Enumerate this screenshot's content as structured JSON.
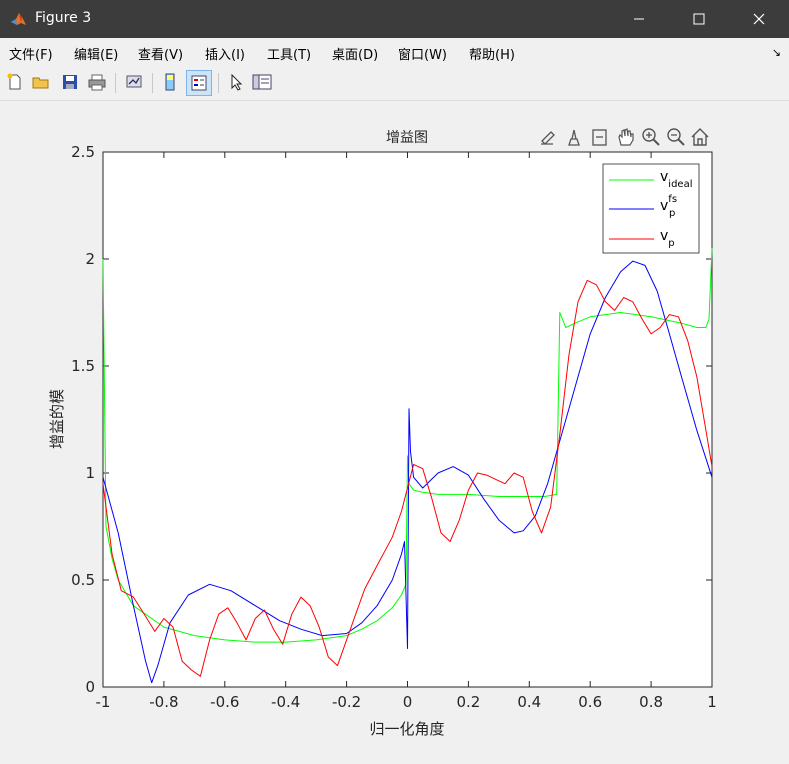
{
  "window": {
    "title": "Figure 3"
  },
  "menu": [
    "文件(F)",
    "编辑(E)",
    "查看(V)",
    "插入(I)",
    "工具(T)",
    "桌面(D)",
    "窗口(W)",
    "帮助(H)"
  ],
  "toolbar_icons": [
    "new-file-icon",
    "open-folder-icon",
    "save-icon",
    "print-icon",
    "link-plot-icon",
    "colorbar-icon",
    "legend-icon",
    "pointer-icon",
    "property-inspector-icon"
  ],
  "axes_toolbar_icons": [
    "brush-edit-icon",
    "data-cursor-icon",
    "zoom-region-icon",
    "pan-icon",
    "zoom-in-icon",
    "zoom-out-icon",
    "home-icon"
  ],
  "colors": {
    "ideal": "#00ff00",
    "pfs": "#0000ff",
    "p": "#ff0000",
    "titlebar": "#3c3c3c"
  },
  "chart_data": {
    "type": "line",
    "title": "增益图",
    "xlabel": "归一化角度",
    "ylabel": "增益的模",
    "xlim": [
      -1,
      1
    ],
    "ylim": [
      0,
      2.5
    ],
    "xticks": [
      -1,
      -0.8,
      -0.6,
      -0.4,
      -0.2,
      0,
      0.2,
      0.4,
      0.6,
      0.8,
      1
    ],
    "xtick_labels": [
      "-1",
      "-0.8",
      "-0.6",
      "-0.4",
      "-0.2",
      "0",
      "0.2",
      "0.4",
      "0.6",
      "0.8",
      "1"
    ],
    "yticks": [
      0,
      0.5,
      1,
      1.5,
      2,
      2.5
    ],
    "ytick_labels": [
      "0",
      "0.5",
      "1",
      "1.5",
      "2",
      "2.5"
    ],
    "legend_position": "top-right",
    "series": [
      {
        "name": "v_ideal",
        "legend_base": "v",
        "legend_sub": "ideal",
        "legend_sup": "",
        "color": "#00ff00",
        "x": [
          -1.0,
          -0.99,
          -0.97,
          -0.95,
          -0.9,
          -0.8,
          -0.7,
          -0.6,
          -0.5,
          -0.4,
          -0.3,
          -0.2,
          -0.15,
          -0.1,
          -0.05,
          -0.02,
          -0.005,
          0.0,
          0.005,
          0.02,
          0.05,
          0.1,
          0.2,
          0.3,
          0.4,
          0.45,
          0.49,
          0.5,
          0.52,
          0.55,
          0.6,
          0.7,
          0.8,
          0.9,
          0.95,
          0.98,
          0.99,
          1.0
        ],
        "y": [
          2.0,
          0.75,
          0.6,
          0.5,
          0.38,
          0.28,
          0.24,
          0.22,
          0.21,
          0.21,
          0.22,
          0.24,
          0.27,
          0.31,
          0.37,
          0.43,
          0.48,
          1.08,
          0.95,
          0.92,
          0.91,
          0.9,
          0.9,
          0.89,
          0.89,
          0.89,
          0.9,
          1.75,
          1.68,
          1.7,
          1.73,
          1.75,
          1.73,
          1.7,
          1.68,
          1.68,
          1.72,
          2.05
        ]
      },
      {
        "name": "v_p^fs",
        "legend_base": "v",
        "legend_sub": "p",
        "legend_sup": "fs",
        "color": "#0000ff",
        "x": [
          -1.0,
          -0.95,
          -0.9,
          -0.86,
          -0.84,
          -0.82,
          -0.78,
          -0.72,
          -0.65,
          -0.58,
          -0.5,
          -0.42,
          -0.35,
          -0.28,
          -0.2,
          -0.15,
          -0.1,
          -0.05,
          -0.02,
          -0.01,
          0.0,
          0.005,
          0.01,
          0.02,
          0.05,
          0.1,
          0.15,
          0.2,
          0.25,
          0.3,
          0.35,
          0.38,
          0.42,
          0.46,
          0.5,
          0.55,
          0.6,
          0.65,
          0.7,
          0.74,
          0.78,
          0.82,
          0.86,
          0.9,
          0.95,
          1.0
        ],
        "y": [
          0.98,
          0.72,
          0.38,
          0.12,
          0.02,
          0.1,
          0.3,
          0.43,
          0.48,
          0.45,
          0.38,
          0.31,
          0.27,
          0.24,
          0.25,
          0.3,
          0.38,
          0.5,
          0.62,
          0.68,
          0.18,
          1.3,
          1.1,
          0.98,
          0.93,
          1.0,
          1.03,
          0.99,
          0.88,
          0.78,
          0.72,
          0.73,
          0.8,
          0.95,
          1.15,
          1.4,
          1.65,
          1.82,
          1.94,
          1.99,
          1.97,
          1.85,
          1.65,
          1.45,
          1.2,
          0.98
        ]
      },
      {
        "name": "v_p",
        "legend_base": "v",
        "legend_sub": "p",
        "legend_sup": "",
        "color": "#ff0000",
        "x": [
          -1.0,
          -0.97,
          -0.94,
          -0.9,
          -0.86,
          -0.83,
          -0.8,
          -0.77,
          -0.74,
          -0.71,
          -0.68,
          -0.65,
          -0.62,
          -0.59,
          -0.56,
          -0.53,
          -0.5,
          -0.47,
          -0.44,
          -0.41,
          -0.38,
          -0.35,
          -0.32,
          -0.29,
          -0.26,
          -0.23,
          -0.2,
          -0.17,
          -0.14,
          -0.11,
          -0.08,
          -0.05,
          -0.02,
          0.0,
          0.02,
          0.05,
          0.08,
          0.11,
          0.14,
          0.17,
          0.2,
          0.23,
          0.26,
          0.29,
          0.32,
          0.35,
          0.38,
          0.41,
          0.44,
          0.47,
          0.5,
          0.53,
          0.56,
          0.59,
          0.62,
          0.65,
          0.68,
          0.71,
          0.74,
          0.77,
          0.8,
          0.83,
          0.86,
          0.89,
          0.92,
          0.95,
          0.98,
          1.0
        ],
        "y": [
          0.95,
          0.62,
          0.45,
          0.42,
          0.33,
          0.26,
          0.32,
          0.28,
          0.12,
          0.08,
          0.05,
          0.22,
          0.34,
          0.37,
          0.3,
          0.22,
          0.32,
          0.36,
          0.27,
          0.2,
          0.34,
          0.42,
          0.38,
          0.28,
          0.14,
          0.1,
          0.22,
          0.34,
          0.46,
          0.54,
          0.62,
          0.7,
          0.82,
          0.93,
          1.04,
          1.02,
          0.88,
          0.72,
          0.68,
          0.78,
          0.92,
          1.0,
          0.99,
          0.97,
          0.95,
          1.0,
          0.98,
          0.82,
          0.72,
          0.84,
          1.18,
          1.55,
          1.8,
          1.9,
          1.88,
          1.8,
          1.76,
          1.82,
          1.8,
          1.72,
          1.65,
          1.68,
          1.74,
          1.73,
          1.62,
          1.45,
          1.2,
          1.03
        ]
      }
    ]
  }
}
